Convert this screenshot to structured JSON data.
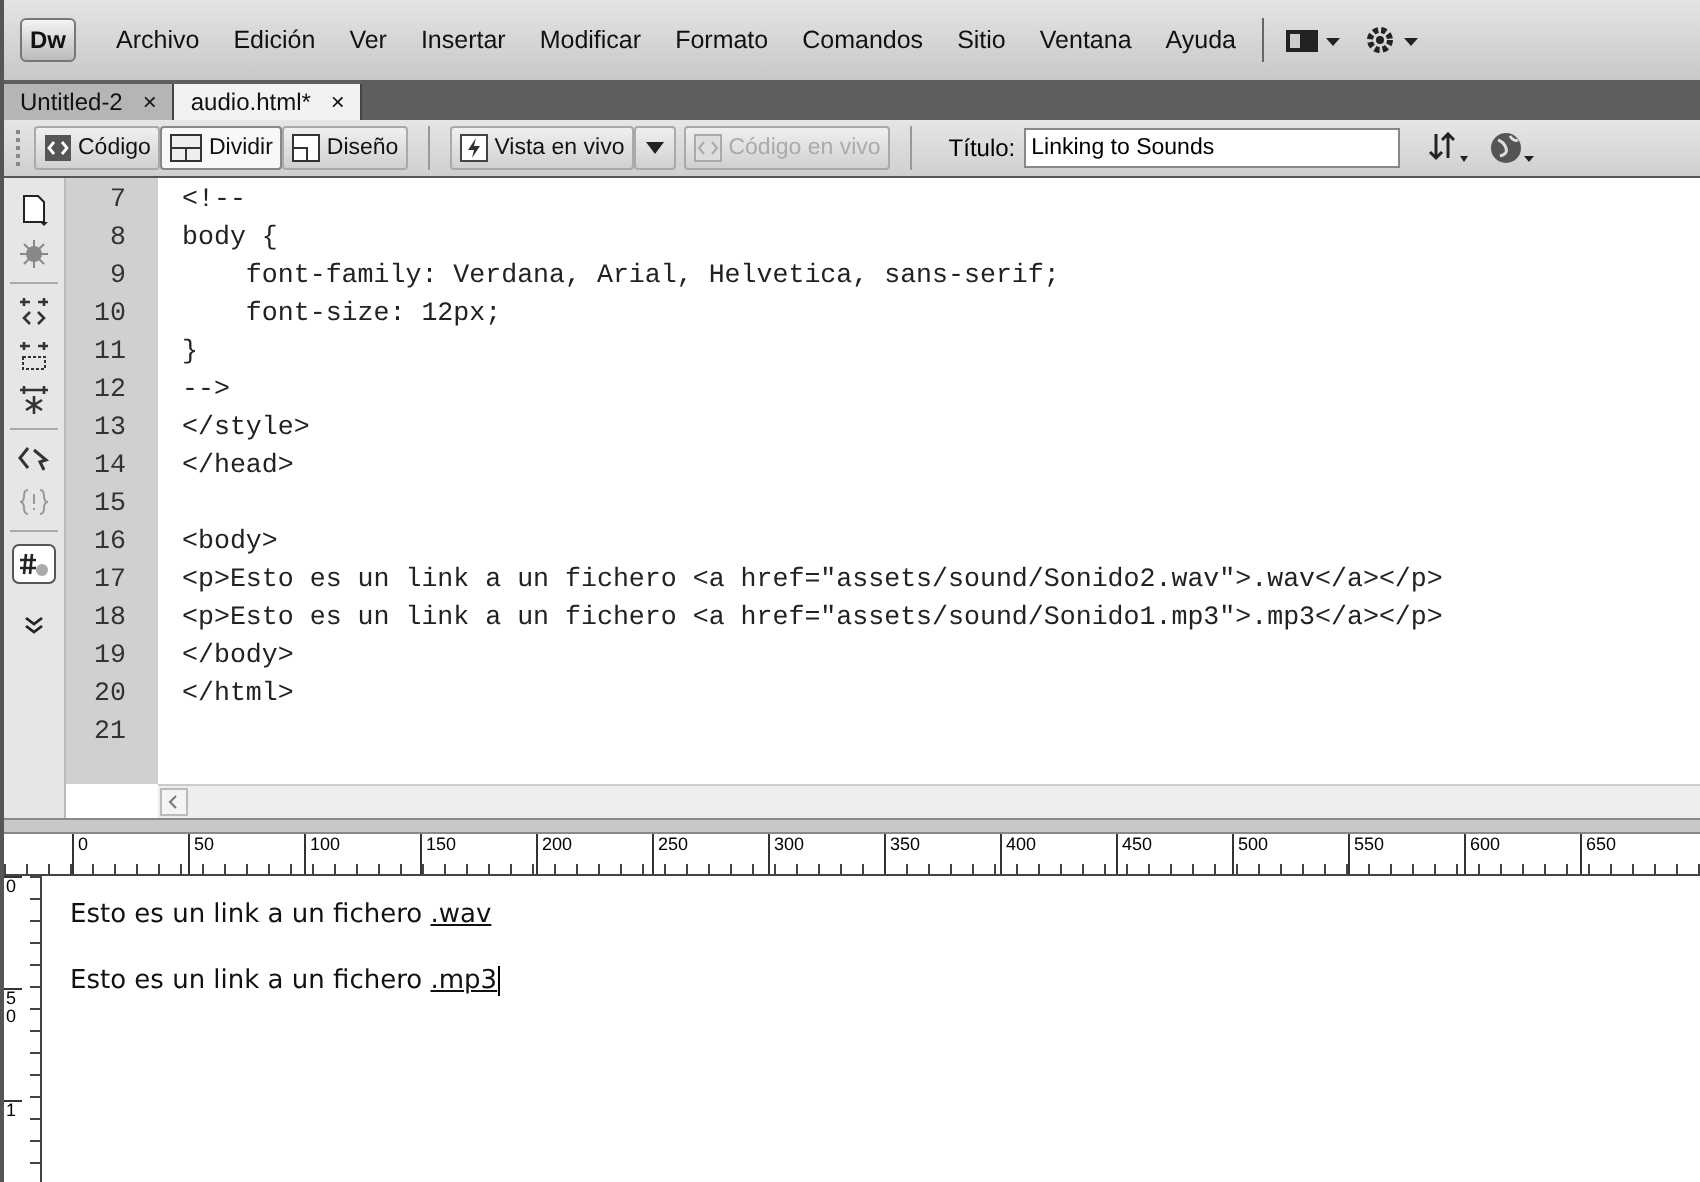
{
  "app_logo": "Dw",
  "menu": [
    "Archivo",
    "Edición",
    "Ver",
    "Insertar",
    "Modificar",
    "Formato",
    "Comandos",
    "Sitio",
    "Ventana",
    "Ayuda"
  ],
  "tabs": [
    {
      "label": "Untitled-2",
      "selected": false,
      "close": "×"
    },
    {
      "label": "audio.html*",
      "selected": true,
      "close": "×"
    }
  ],
  "view_buttons": [
    {
      "kind": "code",
      "label": "Código",
      "selected": false
    },
    {
      "kind": "split",
      "label": "Dividir",
      "selected": true
    },
    {
      "kind": "design",
      "label": "Diseño",
      "selected": false
    }
  ],
  "live_view": {
    "label": "Vista en vivo"
  },
  "live_code": {
    "label": "Código en vivo",
    "disabled": true
  },
  "title_field": {
    "label": "Título:",
    "value": "Linking to Sounds"
  },
  "code_lines": [
    {
      "number": "7",
      "text": "<!--"
    },
    {
      "number": "8",
      "text": "body {"
    },
    {
      "number": "9",
      "text": "    font-family: Verdana, Arial, Helvetica, sans-serif;"
    },
    {
      "number": "10",
      "text": "    font-size: 12px;"
    },
    {
      "number": "11",
      "text": "}"
    },
    {
      "number": "12",
      "text": "-->"
    },
    {
      "number": "13",
      "text": "</style>"
    },
    {
      "number": "14",
      "text": "</head>"
    },
    {
      "number": "15"
    },
    {
      "number": "16",
      "text": "<body>"
    },
    {
      "number": "17",
      "text": "<p>Esto es un link a un fichero <a href=\"assets/sound/Sonido2.wav\">.wav</a></p>"
    },
    {
      "number": "18",
      "text": "<p>Esto es un link a un fichero <a href=\"assets/sound/Sonido1.mp3\">.mp3</a></p>"
    },
    {
      "number": "19",
      "text": "</body>"
    },
    {
      "number": "20",
      "text": "</html>"
    },
    {
      "number": "21"
    }
  ],
  "ruler": {
    "horizontal": [
      "0",
      "50",
      "100",
      "150",
      "200",
      "250",
      "300",
      "350",
      "400",
      "450",
      "500",
      "550",
      "600",
      "650"
    ],
    "vertical": [
      "0",
      "50",
      "1"
    ]
  },
  "design_view": {
    "paragraphs": [
      {
        "text": "Esto es un link a un fichero",
        "link": ".wav",
        "cursor": false
      },
      {
        "text": "Esto es un link a un fichero",
        "link": ".mp3",
        "cursor": true
      }
    ]
  }
}
